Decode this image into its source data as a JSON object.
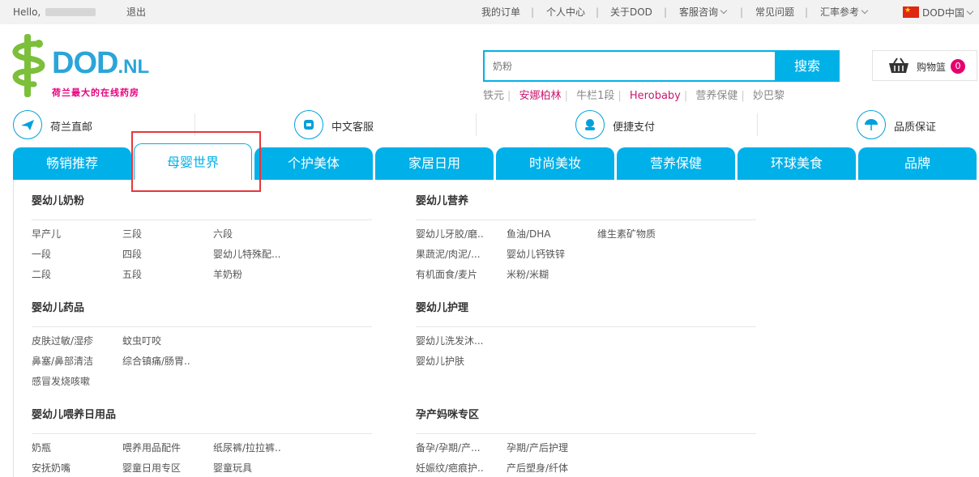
{
  "topbar": {
    "greeting": "Hello,",
    "logout": "退出",
    "links": [
      "我的订单",
      "个人中心",
      "关于DOD",
      "客服咨询",
      "常见问题",
      "汇率参考"
    ],
    "region": "DOD中国",
    "separator": "|"
  },
  "logo": {
    "word": "DOD",
    "suffix": ".NL",
    "tagline": "荷兰最大的在线药房",
    "brand_color": "#2aa5d8",
    "tag_color": "#e6007e"
  },
  "search": {
    "placeholder": "奶粉",
    "button": "搜索",
    "hot": [
      "铁元",
      "安娜柏林",
      "牛栏1段",
      "Herobaby",
      "营养保健",
      "妙巴黎"
    ]
  },
  "cart": {
    "label": "购物篮",
    "count": "0"
  },
  "features": [
    {
      "label": "荷兰直邮",
      "icon": "plane-icon"
    },
    {
      "label": "中文客服",
      "icon": "service-icon"
    },
    {
      "label": "便捷支付",
      "icon": "payment-icon"
    },
    {
      "label": "品质保证",
      "icon": "umbrella-icon"
    }
  ],
  "nav": {
    "tabs": [
      "畅销推荐",
      "母婴世界",
      "个护美体",
      "家居日用",
      "时尚美妆",
      "营养保健",
      "环球美食",
      "品牌"
    ],
    "active_index": 1,
    "accent": "#00b0e8"
  },
  "menu": {
    "infant_formula": {
      "title": "婴幼儿奶粉",
      "items": [
        "早产儿",
        "三段",
        "六段",
        "一段",
        "四段",
        "婴幼儿特殊配...",
        "二段",
        "五段",
        "羊奶粉"
      ]
    },
    "infant_nutrition": {
      "title": "婴幼儿营养",
      "items": [
        "婴幼儿牙胶/磨..",
        "鱼油/DHA",
        "维生素矿物质",
        "果蔬泥/肉泥/...",
        "婴幼儿钙铁锌",
        "有机面食/麦片",
        "米粉/米糊"
      ]
    },
    "infant_medicine": {
      "title": "婴幼儿药品",
      "items": [
        "皮肤过敏/湿疹",
        "蚊虫叮咬",
        "鼻塞/鼻部清洁",
        "综合镇痛/肠胃..",
        "感冒发烧咳嗽"
      ]
    },
    "infant_care": {
      "title": "婴幼儿护理",
      "items": [
        "婴幼儿洗发沐...",
        "婴幼儿护肤"
      ]
    },
    "infant_feeding": {
      "title": "婴幼儿喂养日用品",
      "items": [
        "奶瓶",
        "喂养用品配件",
        "纸尿裤/拉拉裤..",
        "安抚奶嘴",
        "婴童日用专区",
        "婴童玩具"
      ]
    },
    "maternity": {
      "title": "孕产妈咪专区",
      "items": [
        "备孕/孕期/产...",
        "孕期/产后护理",
        "妊娠纹/疤痕护..",
        "产后塑身/纤体"
      ]
    }
  }
}
